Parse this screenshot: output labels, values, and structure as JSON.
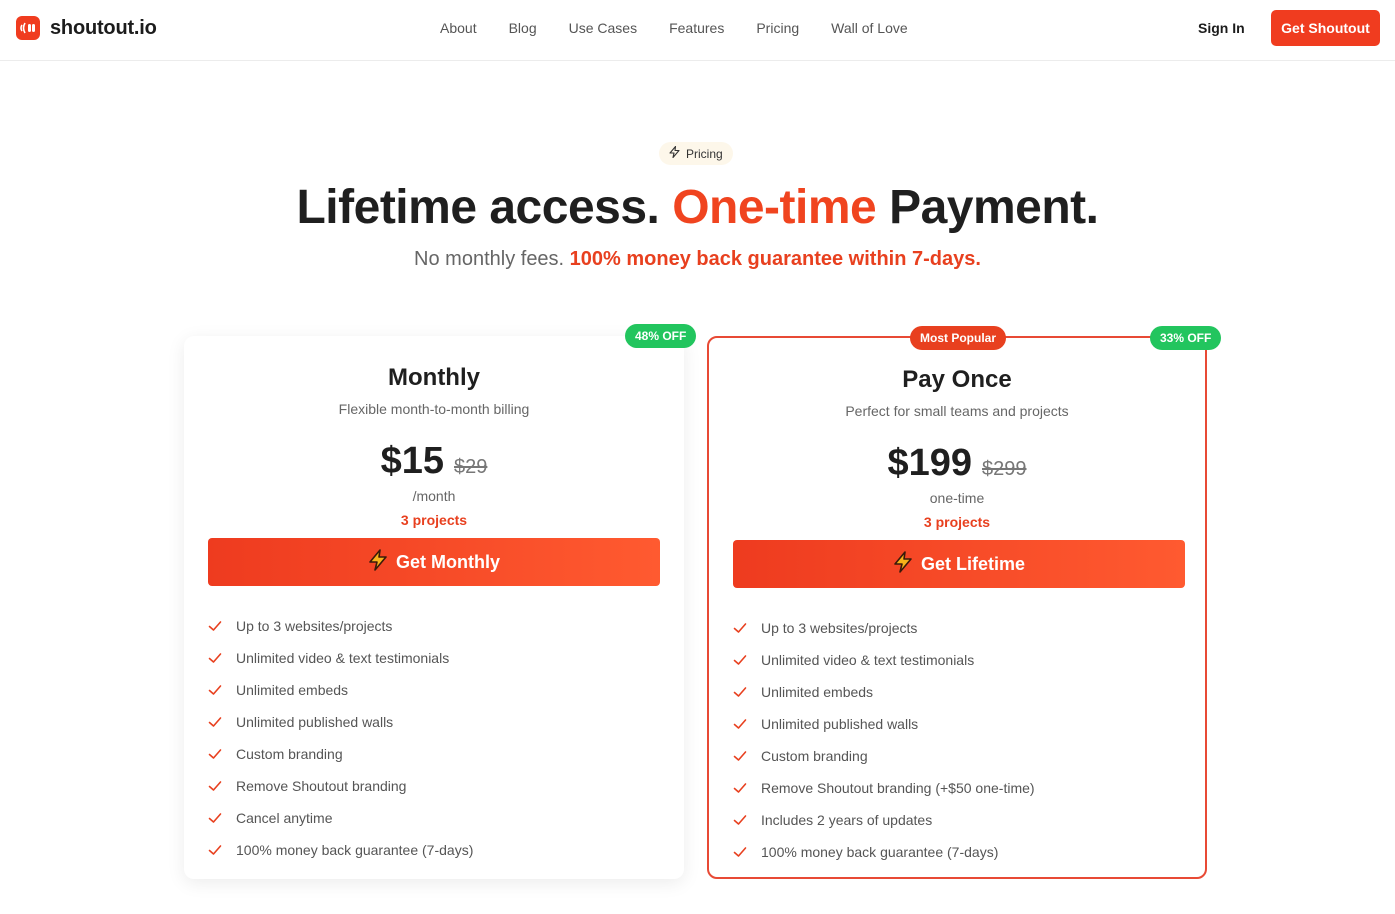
{
  "nav": {
    "logo_text": "shoutout.io",
    "links": [
      "About",
      "Blog",
      "Use Cases",
      "Features",
      "Pricing",
      "Wall of Love"
    ],
    "signin": "Sign In",
    "cta": "Get Shoutout"
  },
  "hero": {
    "badge": "Pricing",
    "headline_pre": "Lifetime access. ",
    "headline_accent": "One-time",
    "headline_post": " Payment.",
    "sub_pre": "No monthly fees. ",
    "sub_accent": "100% money back guarantee within 7-days."
  },
  "plans": [
    {
      "discount": "48% OFF",
      "title": "Monthly",
      "subtitle": "Flexible month-to-month billing",
      "price": "$15",
      "old_price": "$29",
      "period": "/month",
      "projects": "3 projects",
      "button": "Get Monthly",
      "features": [
        "Up to 3 websites/projects",
        "Unlimited video & text testimonials",
        "Unlimited embeds",
        "Unlimited published walls",
        "Custom branding",
        "Remove Shoutout branding",
        "Cancel anytime",
        "100% money back guarantee (7-days)"
      ]
    },
    {
      "popular": "Most Popular",
      "discount": "33% OFF",
      "title": "Pay Once",
      "subtitle": "Perfect for small teams and projects",
      "price": "$199",
      "old_price": "$299",
      "period": "one-time",
      "projects": "3 projects",
      "button": "Get Lifetime",
      "features": [
        "Up to 3 websites/projects",
        "Unlimited video & text testimonials",
        "Unlimited embeds",
        "Unlimited published walls",
        "Custom branding",
        "Remove Shoutout branding (+$50 one-time)",
        "Includes 2 years of updates",
        "100% money back guarantee (7-days)"
      ]
    }
  ],
  "colors": {
    "accent": "#f03c1f",
    "discount_green": "#22c55e",
    "badge_bg": "#fdf7ea"
  }
}
